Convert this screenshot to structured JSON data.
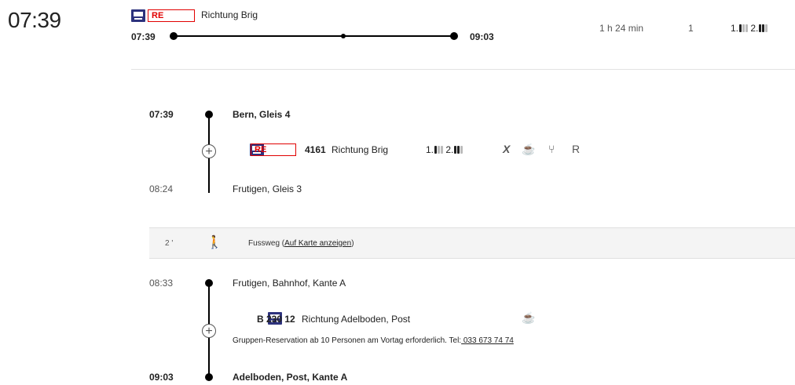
{
  "header": {
    "departure_big": "07:39",
    "badge": "RE",
    "direction": "Richtung Brig",
    "dep_time": "07:39",
    "arr_time": "09:03",
    "duration": "1 h 24 min",
    "transfers": "1",
    "occupancy": {
      "first": "1.",
      "second": "2."
    }
  },
  "leg1": {
    "dep_time": "07:39",
    "dep_station": "Bern, Gleis 4",
    "badge": "RE",
    "train_number": "4161",
    "direction": "Richtung Brig",
    "occupancy": {
      "first": "1.",
      "second": "2."
    },
    "service_icons": [
      "X",
      "☕",
      "⑂",
      "R"
    ],
    "arr_time": "08:24",
    "arr_station": "Frutigen, Gleis 3"
  },
  "walk": {
    "duration": "2 '",
    "label": "Fussweg (",
    "link": "Auf Karte anzeigen",
    "label_end": ")"
  },
  "leg2": {
    "dep_time": "08:33",
    "dep_station": "Frutigen, Bahnhof, Kante A",
    "line": "B 230 12",
    "direction": "Richtung Adelboden, Post",
    "service_icon": "☕",
    "note": "Gruppen-Reservation ab 10 Personen am Vortag erforderlich. Tel:",
    "phone": " 033 673 74 74",
    "arr_time": "09:03",
    "arr_station": "Adelboden, Post, Kante A"
  }
}
